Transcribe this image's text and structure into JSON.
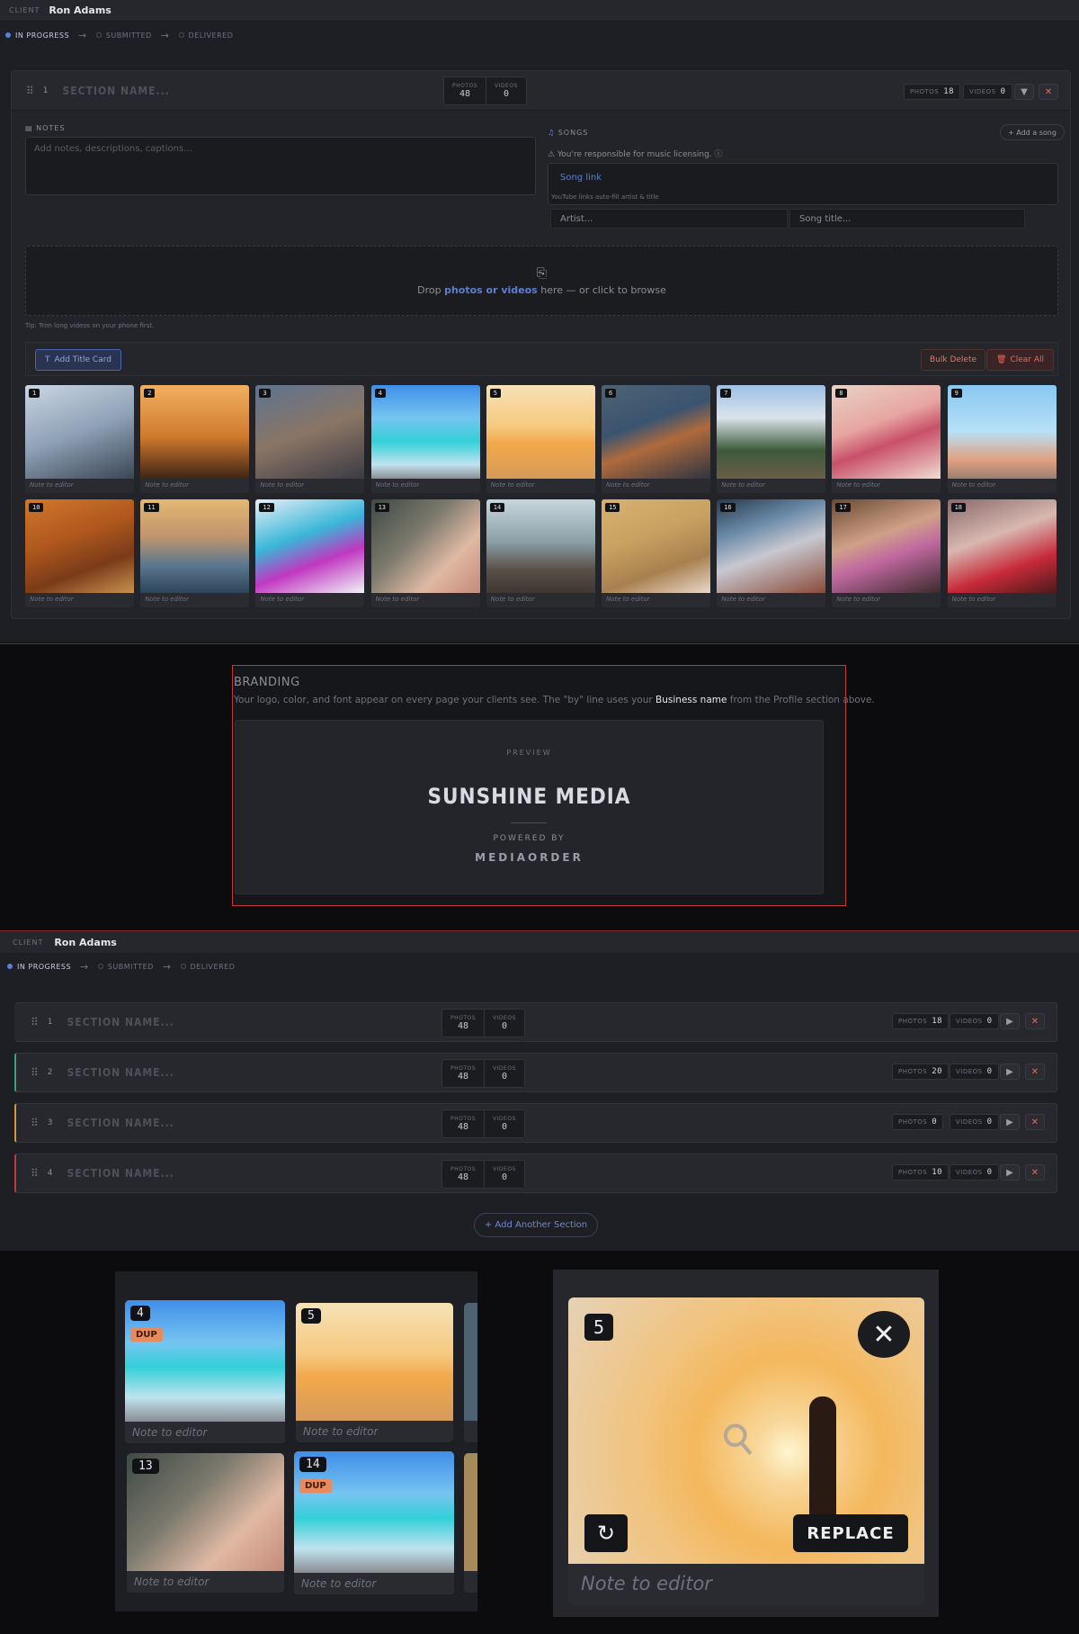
{
  "client": {
    "label": "CLIENT",
    "name": "Ron Adams"
  },
  "status": {
    "steps": [
      "IN PROGRESS",
      "SUBMITTED",
      "DELIVERED"
    ],
    "active": 0
  },
  "section1": {
    "grip": "⠿",
    "number": "1",
    "name_placeholder": "SECTION NAME...",
    "counts": {
      "photos_label": "PHOTOS",
      "photos": "48",
      "videos_label": "VIDEOS",
      "videos": "0"
    },
    "pill_photos": "18",
    "pill_videos": "0",
    "notes_label": "NOTES",
    "notes_placeholder": "Add notes, descriptions, captions...",
    "songs_label": "SONGS",
    "add_song": "+ Add a song",
    "licensing": "You're responsible for music licensing.",
    "song_link": "Song link",
    "yt_hint": "YouTube links auto-fill artist & title",
    "artist_placeholder": "Artist...",
    "title_placeholder": "Song title...",
    "drop": {
      "pre": "Drop ",
      "bold": "photos or videos",
      "post": " here — or click to browse"
    },
    "tip": "Tip: Trim long videos on your phone first.",
    "add_title_card": "Add Title Card",
    "bulk_delete": "Bulk Delete",
    "clear_all": "Clear All",
    "note_placeholder": "Note to editor",
    "thumbs": [
      "1",
      "2",
      "3",
      "4",
      "5",
      "6",
      "7",
      "8",
      "9",
      "10",
      "11",
      "12",
      "13",
      "14",
      "15",
      "16",
      "17",
      "18"
    ]
  },
  "branding": {
    "title": "BRANDING",
    "desc_pre": "Your logo, color, and font appear on every page your clients see. The \"by\" line uses your ",
    "desc_bold": "Business name",
    "desc_post": " from the Profile section above.",
    "preview_label": "PREVIEW",
    "business": "SUNSHINE MEDIA",
    "powered_by": "POWERED BY",
    "company": "MEDIAORDER"
  },
  "sections": [
    {
      "number": "1",
      "name": "SECTION NAME...",
      "photos": "48",
      "videos": "0",
      "pill_photos": "18",
      "pill_videos": "0",
      "accent": "#27282e"
    },
    {
      "number": "2",
      "name": "SECTION NAME...",
      "photos": "48",
      "videos": "0",
      "pill_photos": "20",
      "pill_videos": "0",
      "accent": "#3aa07a"
    },
    {
      "number": "3",
      "name": "SECTION NAME...",
      "photos": "48",
      "videos": "0",
      "pill_photos": "0",
      "pill_videos": "0",
      "accent": "#d09a3a"
    },
    {
      "number": "4",
      "name": "SECTION NAME...",
      "photos": "48",
      "videos": "0",
      "pill_photos": "10",
      "pill_videos": "0",
      "accent": "#c23a3a"
    }
  ],
  "add_section": "+ Add Another Section",
  "zoom_left": {
    "cards": [
      {
        "num": "4",
        "dup": "DUP",
        "note": "Note to editor"
      },
      {
        "num": "5",
        "note": "Note to editor"
      },
      {
        "num": "13",
        "note": "Note to editor"
      },
      {
        "num": "14",
        "dup": "DUP",
        "note": "Note to editor"
      }
    ]
  },
  "zoom_right": {
    "num": "5",
    "replace": "REPLACE",
    "note": "Note to editor"
  },
  "colors": {
    "accent": "#5c7fd6",
    "danger": "#e06a5a",
    "dup": "#e17a2a"
  }
}
